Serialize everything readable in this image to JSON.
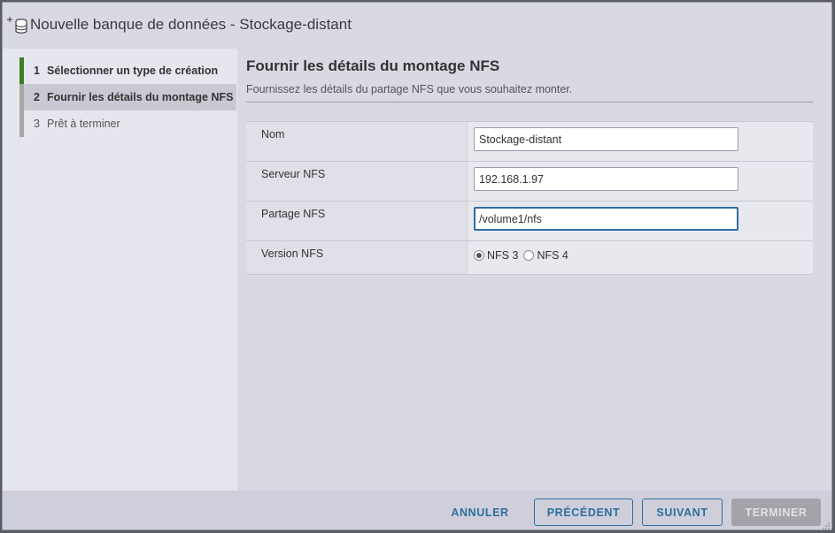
{
  "dialog": {
    "title": "Nouvelle banque de données - Stockage-distant",
    "icon": "add-datastore-icon"
  },
  "steps": [
    {
      "num": "1",
      "label": "Sélectionner un type de création",
      "state": "done"
    },
    {
      "num": "2",
      "label": "Fournir les détails du montage NFS",
      "state": "active"
    },
    {
      "num": "3",
      "label": "Prêt à terminer",
      "state": "todo"
    }
  ],
  "content": {
    "title": "Fournir les détails du montage NFS",
    "subtitle": "Fournissez les détails du partage NFS que vous souhaitez monter."
  },
  "form": {
    "name": {
      "label": "Nom",
      "value": "Stockage-distant"
    },
    "server": {
      "label": "Serveur NFS",
      "value": "192.168.1.97"
    },
    "share": {
      "label": "Partage NFS",
      "value": "/volume1/nfs"
    },
    "version": {
      "label": "Version NFS",
      "options": [
        "NFS 3",
        "NFS 4"
      ],
      "selected": "NFS 3"
    }
  },
  "footer": {
    "cancel": "ANNULER",
    "previous": "PRÉCÉDENT",
    "next": "SUIVANT",
    "finish": "TERMINER"
  },
  "colors": {
    "accent": "#2c6e9e",
    "step_done": "#3d7e25",
    "disabled": "#a3a3aa"
  }
}
